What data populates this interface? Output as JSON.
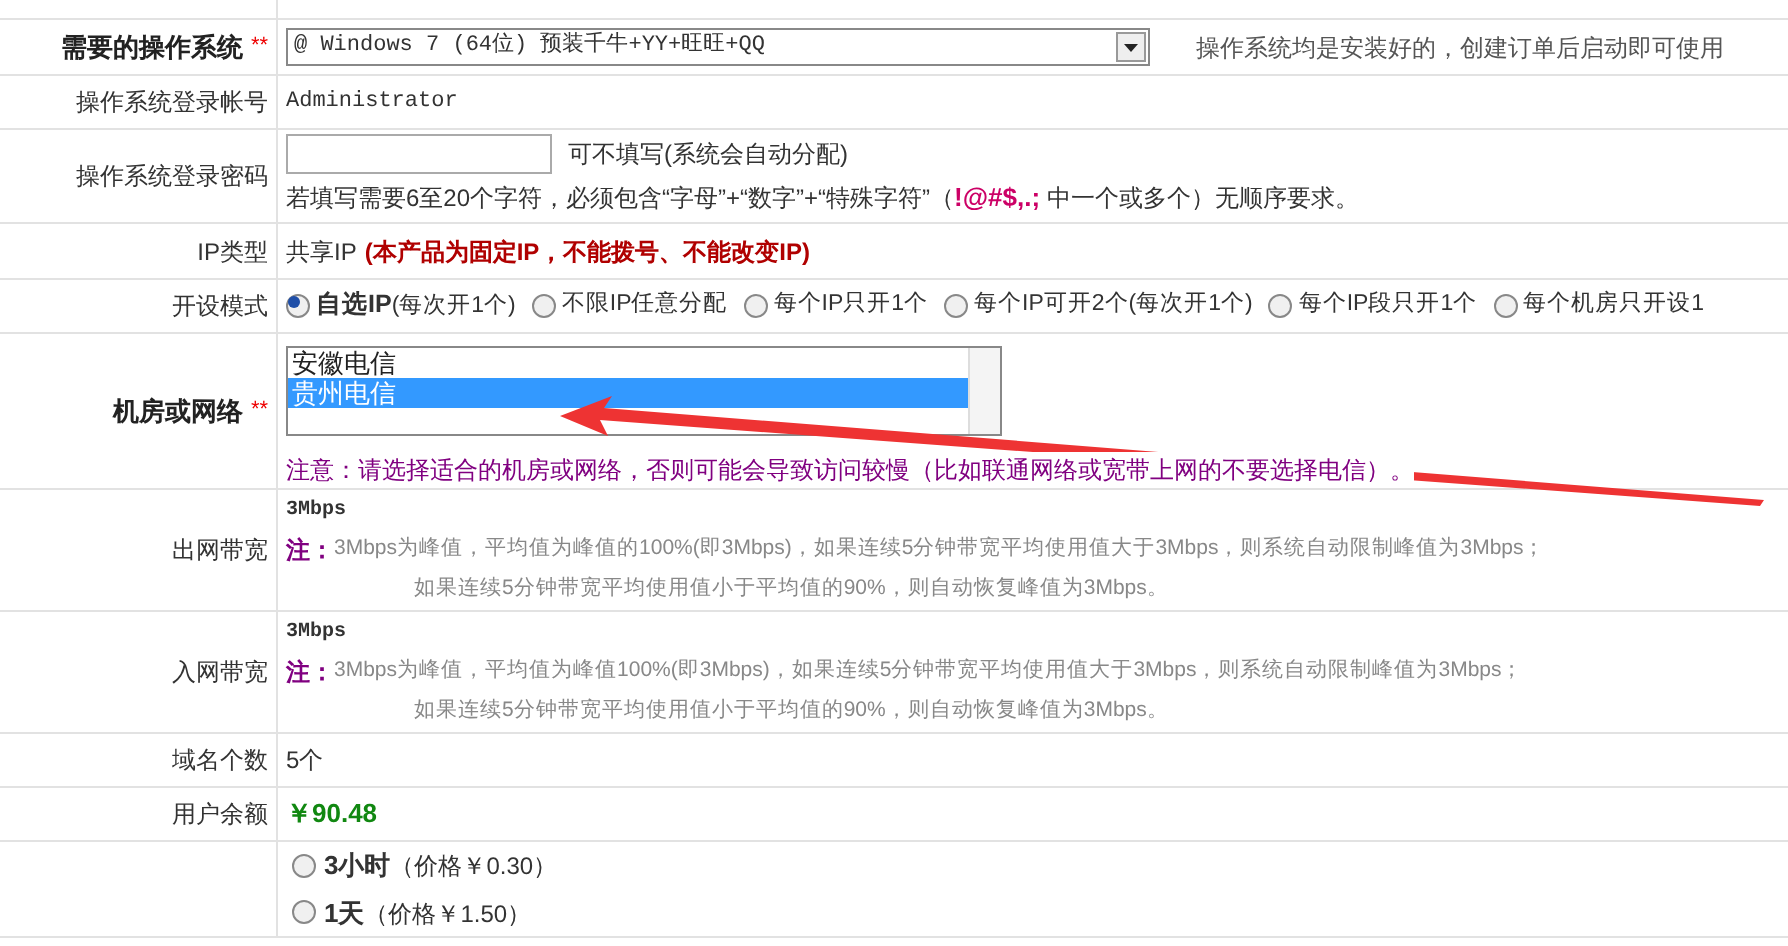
{
  "rows": [
    {
      "kind": "select",
      "label": "需要的操作系统",
      "required_mark": "**",
      "value": "@ Windows 7 (64位) 预装千牛+YY+旺旺+QQ",
      "note": "操作系统均是安装好的，创建订单后启动即可使用"
    },
    {
      "kind": "text",
      "label": "操作系统登录帐号",
      "value": "Administrator"
    },
    {
      "kind": "password",
      "label": "操作系统登录密码",
      "hint": "可不填写(系统会自动分配)",
      "rule": "若填写需要6至20个字符，必须包含“字母”+“数字”+“特殊字符”（**!@#$,.;** 中一个或多个）无顺序要求。"
    },
    {
      "kind": "iptype",
      "label": "IP类型",
      "value": "共享IP",
      "note": "(本产品为固定IP，不能拨号、不能改变IP)"
    },
    {
      "kind": "radios",
      "label": "开设模式",
      "options": [
        {
          "label": "**自选IP**(每次开1个)",
          "selected": true
        },
        {
          "label": "不限IP任意分配",
          "selected": false
        },
        {
          "label": "每个IP只开1个",
          "selected": false
        },
        {
          "label": "每个IP可开2个(每次开1个)",
          "selected": false
        },
        {
          "label": "每个IP段只开1个",
          "selected": false
        },
        {
          "label": "每个机房只开设1",
          "selected": false
        }
      ]
    },
    {
      "kind": "listbox",
      "label": "机房或网络",
      "required_mark": "**",
      "options": [
        {
          "label": "安徽电信",
          "selected": false
        },
        {
          "label": "贵州电信",
          "selected": true
        }
      ],
      "note": "注意：请选择适合的机房或网络，否则可能会导致访问较慢（比如联通网络或宽带上网的不要选择电信）。"
    },
    {
      "kind": "bandwidth",
      "label": "出网带宽",
      "value": "3Mbps",
      "note_label": "注：",
      "lines": [
        "3Mbps为峰值，平均值为峰值的100%(即3Mbps)，如果连续5分钟带宽平均使用值大于3Mbps，则系统自动限制峰值为3Mbps；",
        "如果连续5分钟带宽平均使用值小于平均值的90%，则自动恢复峰值为3Mbps。"
      ]
    },
    {
      "kind": "bandwidth",
      "label": "入网带宽",
      "value": "3Mbps",
      "note_label": "注：",
      "lines": [
        "3Mbps为峰值，平均值为峰值100%(即3Mbps)，如果连续5分钟带宽平均使用值大于3Mbps，则系统自动限制峰值为3Mbps；",
        "如果连续5分钟带宽平均使用值小于平均值的90%，则自动恢复峰值为3Mbps。"
      ]
    },
    {
      "kind": "text",
      "label": "域名个数",
      "value": "5个"
    },
    {
      "kind": "money",
      "label": "用户余额",
      "value": "￥90.48"
    },
    {
      "kind": "durations",
      "options": [
        {
          "label": "**3小时**（价格￥0.30）",
          "selected": false
        },
        {
          "label": "**1天**（价格￥1.50）",
          "selected": false
        }
      ]
    }
  ]
}
